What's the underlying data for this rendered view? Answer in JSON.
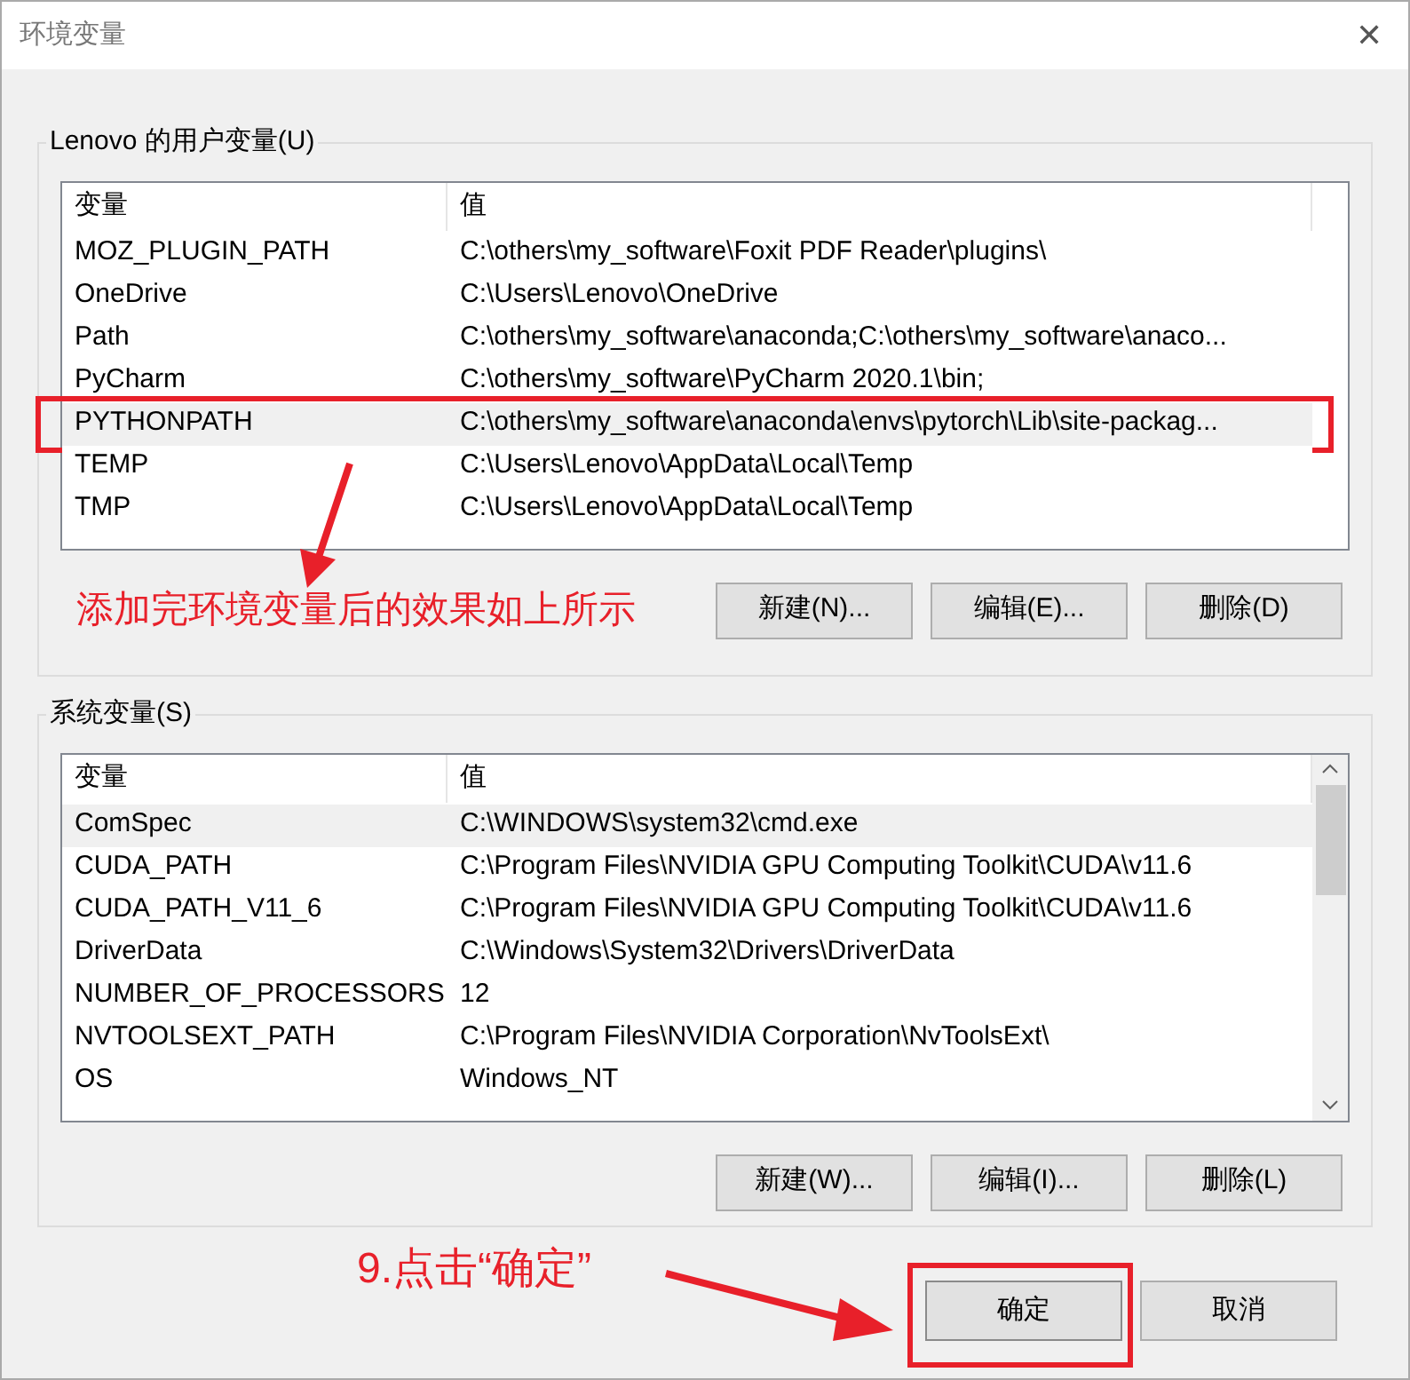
{
  "window": {
    "title": "环境变量",
    "close": "✕"
  },
  "user_vars": {
    "label": "Lenovo 的用户变量(U)",
    "columns": [
      "变量",
      "值"
    ],
    "rows": [
      {
        "name": "MOZ_PLUGIN_PATH",
        "value": "C:\\others\\my_software\\Foxit PDF Reader\\plugins\\",
        "selected": false,
        "highlighted": false
      },
      {
        "name": "OneDrive",
        "value": "C:\\Users\\Lenovo\\OneDrive",
        "selected": false,
        "highlighted": false
      },
      {
        "name": "Path",
        "value": "C:\\others\\my_software\\anaconda;C:\\others\\my_software\\anaco...",
        "selected": false,
        "highlighted": false
      },
      {
        "name": "PyCharm",
        "value": "C:\\others\\my_software\\PyCharm 2020.1\\bin;",
        "selected": false,
        "highlighted": false
      },
      {
        "name": "PYTHONPATH",
        "value": "C:\\others\\my_software\\anaconda\\envs\\pytorch\\Lib\\site-packag...",
        "selected": true,
        "highlighted": true
      },
      {
        "name": "TEMP",
        "value": "C:\\Users\\Lenovo\\AppData\\Local\\Temp",
        "selected": false,
        "highlighted": false
      },
      {
        "name": "TMP",
        "value": "C:\\Users\\Lenovo\\AppData\\Local\\Temp",
        "selected": false,
        "highlighted": false
      }
    ],
    "note": "添加完环境变量后的效果如上所示",
    "buttons": [
      "新建(N)...",
      "编辑(E)...",
      "删除(D)"
    ]
  },
  "system_vars": {
    "label": "系统变量(S)",
    "columns": [
      "变量",
      "值"
    ],
    "rows": [
      {
        "name": "ComSpec",
        "value": "C:\\WINDOWS\\system32\\cmd.exe",
        "selected": true,
        "highlighted": false
      },
      {
        "name": "CUDA_PATH",
        "value": "C:\\Program Files\\NVIDIA GPU Computing Toolkit\\CUDA\\v11.6",
        "selected": false,
        "highlighted": false
      },
      {
        "name": "CUDA_PATH_V11_6",
        "value": "C:\\Program Files\\NVIDIA GPU Computing Toolkit\\CUDA\\v11.6",
        "selected": false,
        "highlighted": false
      },
      {
        "name": "DriverData",
        "value": "C:\\Windows\\System32\\Drivers\\DriverData",
        "selected": false,
        "highlighted": false
      },
      {
        "name": "NUMBER_OF_PROCESSORS",
        "value": "12",
        "selected": false,
        "highlighted": false
      },
      {
        "name": "NVTOOLSEXT_PATH",
        "value": "C:\\Program Files\\NVIDIA Corporation\\NvToolsExt\\",
        "selected": false,
        "highlighted": false
      },
      {
        "name": "OS",
        "value": "Windows_NT",
        "selected": false,
        "highlighted": false
      }
    ],
    "buttons": [
      "新建(W)...",
      "编辑(I)...",
      "删除(L)"
    ]
  },
  "step_note": "9.点击“确定”",
  "footer_buttons": [
    {
      "label": "确定",
      "highlighted": true
    },
    {
      "label": "取消",
      "highlighted": false
    }
  ]
}
